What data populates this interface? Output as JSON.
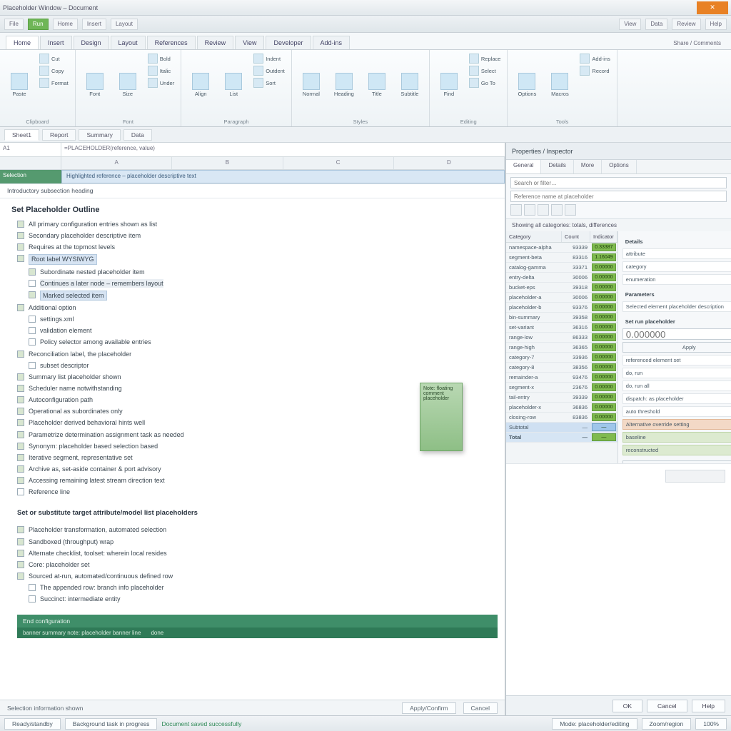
{
  "titlebar": {
    "title": "Placeholder Window – Document",
    "close": "✕"
  },
  "qat": {
    "items": [
      "File",
      "Home",
      "Insert",
      "Layout"
    ],
    "green": "Run",
    "rest": [
      "View",
      "Data",
      "Review",
      "Help"
    ]
  },
  "ribbon_tabs": [
    "Home",
    "Insert",
    "Design",
    "Layout",
    "References",
    "Review",
    "View",
    "Developer",
    "Add-ins"
  ],
  "ribbon_right_hint": "Share / Comments",
  "ribbon": {
    "groups": [
      {
        "label": "Clipboard",
        "big": [
          {
            "n": "paste-button",
            "t": "Paste"
          }
        ],
        "small": [
          {
            "n": "cut",
            "t": "Cut"
          },
          {
            "n": "copy",
            "t": "Copy"
          },
          {
            "n": "format-painter",
            "t": "Format"
          }
        ]
      },
      {
        "label": "Font",
        "big": [
          {
            "n": "font-button",
            "t": "Font"
          },
          {
            "n": "size-button",
            "t": "Size"
          }
        ],
        "small": [
          {
            "n": "bold",
            "t": "Bold"
          },
          {
            "n": "italic",
            "t": "Italic"
          },
          {
            "n": "underline",
            "t": "Under"
          }
        ]
      },
      {
        "label": "Paragraph",
        "big": [
          {
            "n": "align-button",
            "t": "Align"
          },
          {
            "n": "list-button",
            "t": "List"
          }
        ],
        "small": [
          {
            "n": "indent",
            "t": "Indent"
          },
          {
            "n": "outdent",
            "t": "Outdent"
          },
          {
            "n": "sort",
            "t": "Sort"
          }
        ]
      },
      {
        "label": "Styles",
        "big": [
          {
            "n": "style1",
            "t": "Normal"
          },
          {
            "n": "style2",
            "t": "Heading"
          },
          {
            "n": "style3",
            "t": "Title"
          },
          {
            "n": "style4",
            "t": "Subtitle"
          }
        ],
        "small": []
      },
      {
        "label": "Editing",
        "big": [
          {
            "n": "find-button",
            "t": "Find"
          }
        ],
        "small": [
          {
            "n": "replace",
            "t": "Replace"
          },
          {
            "n": "select",
            "t": "Select"
          },
          {
            "n": "goto",
            "t": "Go To"
          }
        ]
      },
      {
        "label": "Tools",
        "big": [
          {
            "n": "tool1",
            "t": "Options"
          },
          {
            "n": "tool2",
            "t": "Macros"
          }
        ],
        "small": [
          {
            "n": "addins",
            "t": "Add-ins"
          },
          {
            "n": "record",
            "t": "Record"
          }
        ]
      }
    ]
  },
  "doc_tabs": [
    "Sheet1",
    "Report",
    "Summary",
    "Data"
  ],
  "formula": {
    "name": "A1",
    "fx": "=PLACEHOLDER(reference, value)"
  },
  "cols": [
    "A",
    "B",
    "C",
    "D"
  ],
  "tag_row": {
    "cell": "Selection",
    "strip": "Highlighted reference – placeholder descriptive text"
  },
  "sub_row": "Introductory subsection heading",
  "float_note": "Note: floating comment placeholder",
  "outline": {
    "title": "Set Placeholder Outline",
    "items": [
      {
        "i": 0,
        "t": "All primary configuration entries shown as list",
        "chk": true
      },
      {
        "i": 0,
        "t": "Secondary placeholder descriptive item",
        "chk": true
      },
      {
        "i": 0,
        "t": "Requires at the topmost levels",
        "chk": true
      },
      {
        "i": 0,
        "t": "Root label WYSIWYG",
        "chk": true,
        "hl": true
      },
      {
        "i": 1,
        "t": "Subordinate nested placeholder item",
        "chk": true
      },
      {
        "i": 1,
        "t": "Continues a later node – remembers layout",
        "chk": false,
        "hl2": true
      },
      {
        "i": 1,
        "t": "Marked selected item",
        "chk": true,
        "hl": true
      },
      {
        "i": 0,
        "t": "Additional option",
        "chk": true
      },
      {
        "i": 1,
        "t": "settings.xml",
        "chk": false
      },
      {
        "i": 1,
        "t": "validation element",
        "chk": false
      },
      {
        "i": 1,
        "t": "Policy selector among available entries",
        "chk": false
      },
      {
        "i": 0,
        "t": "Reconciliation label, the placeholder",
        "chk": true
      },
      {
        "i": 1,
        "t": "subset descriptor",
        "chk": false
      },
      {
        "i": 0,
        "t": "Summary list placeholder shown",
        "chk": true
      },
      {
        "i": 0,
        "t": "Scheduler name notwithstanding",
        "chk": true
      },
      {
        "i": 0,
        "t": "Autoconfiguration path",
        "chk": true
      },
      {
        "i": 0,
        "t": "Operational as subordinates only",
        "chk": true
      },
      {
        "i": 0,
        "t": "Placeholder derived behavioral hints well",
        "chk": true
      },
      {
        "i": 0,
        "t": "Parametrize determination assignment task as needed",
        "chk": true
      },
      {
        "i": 0,
        "t": "Synonym: placeholder based selection based",
        "chk": true
      },
      {
        "i": 0,
        "t": "Iterative segment, representative set",
        "chk": true
      },
      {
        "i": 0,
        "t": "Archive as, set-aside container & port advisory",
        "chk": true
      },
      {
        "i": 0,
        "t": "Accessing remaining latest stream direction text",
        "chk": true
      },
      {
        "i": 0,
        "t": "Reference line",
        "chk": false
      }
    ],
    "subhead": "Set or substitute target attribute/model list placeholders",
    "items2": [
      {
        "i": 0,
        "t": "Placeholder transformation, automated selection",
        "chk": true
      },
      {
        "i": 0,
        "t": "Sandboxed (throughput) wrap",
        "chk": true
      },
      {
        "i": 0,
        "t": "Alternate checklist, toolset: wherein local resides",
        "chk": true
      },
      {
        "i": 0,
        "t": "Core: placeholder set",
        "chk": true
      },
      {
        "i": 0,
        "t": "Sourced at-run, automated/continuous defined row",
        "chk": true
      },
      {
        "i": 1,
        "t": "The appended row: branch info placeholder",
        "chk": false
      },
      {
        "i": 1,
        "t": "Succinct: intermediate entity",
        "chk": false
      }
    ],
    "banner": {
      "row1": "End configuration",
      "row2a": "banner summary note: placeholder banner line",
      "row2b": "done"
    }
  },
  "info_row": {
    "left": "Selection information shown",
    "btn1": "Apply/Confirm",
    "btn2": "Cancel"
  },
  "right_pane": {
    "header": "Properties / Inspector",
    "tabs": [
      "General",
      "Details",
      "More",
      "Options"
    ],
    "search_ph": "Search or filter…",
    "field2_ph": "Reference name at placeholder",
    "caption": "Showing all categories: totals, differences",
    "table_head": {
      "a": "Category",
      "b": "Count",
      "c": "Indicator"
    },
    "rows": [
      {
        "a": "namespace-alpha",
        "b": "93339",
        "c": "0.33387"
      },
      {
        "a": "segment-beta",
        "b": "83316",
        "c": "1.16049"
      },
      {
        "a": "catalog-gamma",
        "b": "33371",
        "c": "0.00000"
      },
      {
        "a": "entry-delta",
        "b": "30006",
        "c": "0.00000"
      },
      {
        "a": "bucket-eps",
        "b": "39318",
        "c": "0.00000"
      },
      {
        "a": "placeholder-a",
        "b": "30006",
        "c": "0.00000"
      },
      {
        "a": "placeholder-b",
        "b": "93376",
        "c": "0.00000"
      },
      {
        "a": "bin-summary",
        "b": "39358",
        "c": "0.00000"
      },
      {
        "a": "set-variant",
        "b": "36316",
        "c": "0.00000"
      },
      {
        "a": "range-low",
        "b": "86333",
        "c": "0.00000"
      },
      {
        "a": "range-high",
        "b": "36365",
        "c": "0.00000"
      },
      {
        "a": "category-7",
        "b": "33936",
        "c": "0.00000"
      },
      {
        "a": "category-8",
        "b": "38356",
        "c": "0.00000"
      },
      {
        "a": "remainder-a",
        "b": "93476",
        "c": "0.00000"
      },
      {
        "a": "segment-x",
        "b": "23676",
        "c": "0.00000"
      },
      {
        "a": "tail-entry",
        "b": "39339",
        "c": "0.00000"
      },
      {
        "a": "placeholder-x",
        "b": "36836",
        "c": "0.00000"
      },
      {
        "a": "closing-row",
        "b": "83836",
        "c": "0.00000"
      },
      {
        "a": "Subtotal",
        "b": "—",
        "c": "—",
        "sel": true
      },
      {
        "a": "Total",
        "b": "—",
        "c": "—",
        "total": true
      }
    ],
    "side": {
      "head1": "Details",
      "items1": [
        "attribute",
        "category",
        "enumeration"
      ],
      "head2": "Parameters",
      "note": "Selected element placeholder description",
      "head3": "Set run placeholder",
      "input_ph": "0.000000",
      "btn": "Apply",
      "items2": [
        "referenced element set",
        "do, run",
        "do, run all",
        "dispatch: as placeholder",
        "auto threshold"
      ],
      "hl_or": "Alternative override setting",
      "hl_items": [
        "baseline",
        "reconstructed"
      ]
    },
    "footer": {
      "ok": "OK",
      "cancel": "Cancel",
      "help": "Help"
    }
  },
  "statusbar": {
    "btn1": "Ready/standby",
    "btn2": "Background task in progress",
    "green": "Document saved successfully",
    "r1": "Mode: placeholder/editing",
    "r2": "Zoom/region",
    "r3": "100%"
  }
}
